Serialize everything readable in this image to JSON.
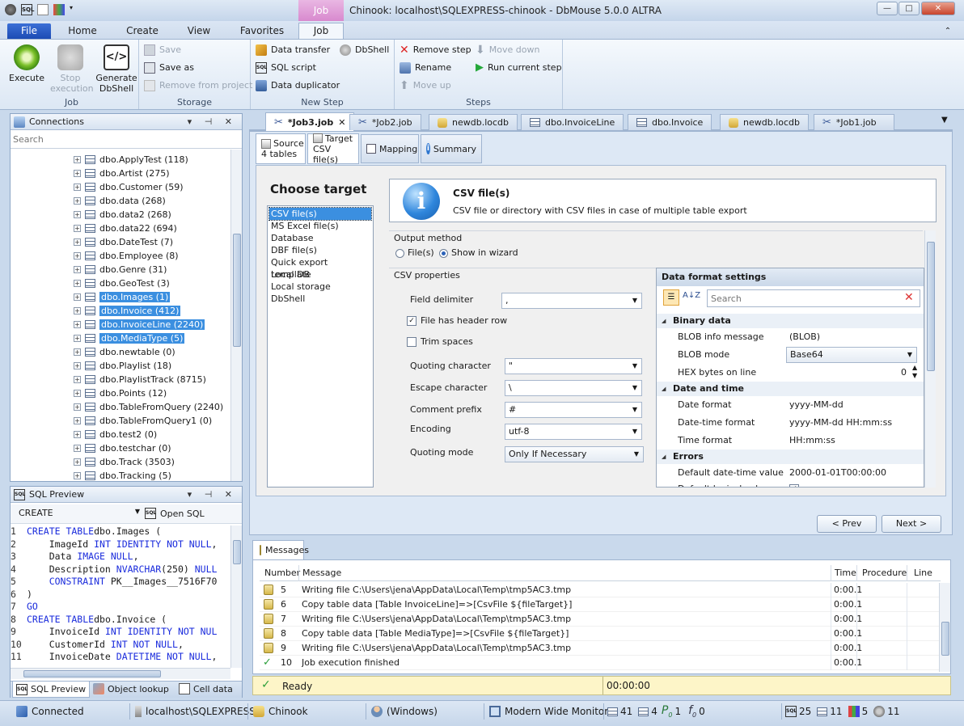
{
  "window": {
    "title": "Chinook: localhost\\SQLEXPRESS-chinook - DbMouse 5.0.0 ALTRA",
    "context_tab": "Job",
    "min": "—",
    "max": "□",
    "close": "✕"
  },
  "ribbon_tabs": [
    "File",
    "Home",
    "Create",
    "View",
    "Favorites",
    "Job"
  ],
  "ribbon": {
    "job_group": {
      "name": "Job",
      "execute": "Execute",
      "stop": "Stop execution",
      "generate": "Generate DbShell"
    },
    "storage_group": {
      "name": "Storage",
      "save": "Save",
      "save_as": "Save as",
      "remove": "Remove from project"
    },
    "newstep_group": {
      "name": "New Step",
      "data_transfer": "Data transfer",
      "dbshell": "DbShell",
      "sql_script": "SQL script",
      "data_duplicator": "Data duplicator"
    },
    "steps_group": {
      "name": "Steps",
      "remove_step": "Remove step",
      "move_down": "Move down",
      "rename": "Rename",
      "run_current": "Run current step",
      "move_up": "Move up"
    }
  },
  "connections": {
    "title": "Connections",
    "search_placeholder": "Search",
    "items": [
      {
        "label": "dbo.ApplyTest (118)",
        "selected": false
      },
      {
        "label": "dbo.Artist (275)",
        "selected": false
      },
      {
        "label": "dbo.Customer (59)",
        "selected": false
      },
      {
        "label": "dbo.data (268)",
        "selected": false
      },
      {
        "label": "dbo.data2 (268)",
        "selected": false
      },
      {
        "label": "dbo.data22 (694)",
        "selected": false
      },
      {
        "label": "dbo.DateTest (7)",
        "selected": false
      },
      {
        "label": "dbo.Employee (8)",
        "selected": false
      },
      {
        "label": "dbo.Genre (31)",
        "selected": false
      },
      {
        "label": "dbo.GeoTest (3)",
        "selected": false
      },
      {
        "label": "dbo.Images (1)",
        "selected": true
      },
      {
        "label": "dbo.Invoice (412)",
        "selected": true
      },
      {
        "label": "dbo.InvoiceLine (2240)",
        "selected": true
      },
      {
        "label": "dbo.MediaType (5)",
        "selected": true
      },
      {
        "label": "dbo.newtable (0)",
        "selected": false
      },
      {
        "label": "dbo.Playlist (18)",
        "selected": false
      },
      {
        "label": "dbo.PlaylistTrack (8715)",
        "selected": false
      },
      {
        "label": "dbo.Points (12)",
        "selected": false
      },
      {
        "label": "dbo.TableFromQuery (2240)",
        "selected": false
      },
      {
        "label": "dbo.TableFromQuery1 (0)",
        "selected": false
      },
      {
        "label": "dbo.test2 (0)",
        "selected": false
      },
      {
        "label": "dbo.testchar (0)",
        "selected": false
      },
      {
        "label": "dbo.Track (3503)",
        "selected": false
      },
      {
        "label": "dbo.Tracking (5)",
        "selected": false
      }
    ]
  },
  "sql_preview": {
    "title": "SQL Preview",
    "mode": "CREATE",
    "open_sql": "Open SQL",
    "lines": [
      {
        "n": "1",
        "parts": [
          [
            "kw",
            "CREATE TABLE"
          ],
          [
            "",
            "dbo.Images ("
          ]
        ]
      },
      {
        "n": "2",
        "parts": [
          [
            "",
            "    ImageId "
          ],
          [
            "kw",
            "INT IDENTITY NOT NULL"
          ],
          [
            "",
            ","
          ]
        ]
      },
      {
        "n": "3",
        "parts": [
          [
            "",
            "    Data "
          ],
          [
            "kw",
            "IMAGE NULL"
          ],
          [
            "",
            ","
          ]
        ]
      },
      {
        "n": "4",
        "parts": [
          [
            "",
            "    Description "
          ],
          [
            "kw",
            "NVARCHAR"
          ],
          [
            "",
            "(250) "
          ],
          [
            "kw",
            "NULL"
          ]
        ]
      },
      {
        "n": "5",
        "parts": [
          [
            "",
            "    "
          ],
          [
            "kw",
            "CONSTRAINT"
          ],
          [
            "",
            " PK__Images__7516F70"
          ]
        ]
      },
      {
        "n": "6",
        "parts": [
          [
            "",
            ")"
          ]
        ]
      },
      {
        "n": "7",
        "parts": [
          [
            "kw",
            "GO"
          ]
        ]
      },
      {
        "n": "8",
        "parts": [
          [
            "kw",
            "CREATE TABLE"
          ],
          [
            "",
            "dbo.Invoice ("
          ]
        ]
      },
      {
        "n": "9",
        "parts": [
          [
            "",
            "    InvoiceId "
          ],
          [
            "kw",
            "INT IDENTITY NOT NUL"
          ]
        ]
      },
      {
        "n": "10",
        "parts": [
          [
            "",
            "    CustomerId "
          ],
          [
            "kw",
            "INT NOT NULL"
          ],
          [
            "",
            ","
          ]
        ]
      },
      {
        "n": "11",
        "parts": [
          [
            "",
            "    InvoiceDate "
          ],
          [
            "kw",
            "DATETIME NOT NULL"
          ],
          [
            "",
            ","
          ]
        ]
      }
    ],
    "bottom_tabs": [
      "SQL Preview",
      "Object lookup",
      "Cell data"
    ]
  },
  "doc_tabs": [
    "*Job3.job",
    "*Job2.job",
    "newdb.locdb",
    "dbo.InvoiceLine",
    "dbo.Invoice",
    "newdb.locdb",
    "*Job1.job"
  ],
  "wizard": {
    "tabs": [
      {
        "title": "Source",
        "sub": "4 tables"
      },
      {
        "title": "Target",
        "sub": "CSV file(s)"
      },
      {
        "title": "Mapping",
        "sub": ""
      },
      {
        "title": "Summary",
        "sub": ""
      }
    ],
    "choose_target": "Choose target",
    "targets": [
      "CSV file(s)",
      "MS Excel file(s)",
      "Database",
      "DBF file(s)",
      "Quick export template",
      "Local DB",
      "Local storage",
      "DbShell"
    ],
    "info": {
      "title": "CSV file(s)",
      "desc": "CSV file or directory with CSV files in case of multiple table export"
    },
    "output_method": {
      "label": "Output method",
      "opt1": "File(s)",
      "opt2": "Show in wizard"
    },
    "csv": {
      "label": "CSV properties",
      "field_delimiter": {
        "label": "Field delimiter",
        "value": ","
      },
      "header_row": "File has header row",
      "trim_spaces": "Trim spaces",
      "quoting_character": {
        "label": "Quoting character",
        "value": "\""
      },
      "escape_character": {
        "label": "Escape character",
        "value": "\\"
      },
      "comment_prefix": {
        "label": "Comment prefix",
        "value": "#"
      },
      "encoding": {
        "label": "Encoding",
        "value": "utf-8"
      },
      "quoting_mode": {
        "label": "Quoting mode",
        "value": "Only If Necessary"
      }
    },
    "format": {
      "title": "Data format settings",
      "search_placeholder": "Search",
      "binary": {
        "cat": "Binary data",
        "blob_info_k": "BLOB info message",
        "blob_info_v": "(BLOB)",
        "blob_mode_k": "BLOB mode",
        "blob_mode_v": "Base64",
        "hex_k": "HEX bytes on line",
        "hex_v": "0"
      },
      "datetime": {
        "cat": "Date and time",
        "date_k": "Date format",
        "date_v": "yyyy-MM-dd",
        "dt_k": "Date-time format",
        "dt_v": "yyyy-MM-dd HH:mm:ss",
        "time_k": "Time format",
        "time_v": "HH:mm:ss"
      },
      "errors": {
        "cat": "Errors",
        "def_dt_k": "Default date-time value",
        "def_dt_v": "2000-01-01T00:00:00",
        "def_log_k": "Default logical value"
      }
    },
    "prev": "< Prev",
    "next": "Next >"
  },
  "messages": {
    "tab": "Messages",
    "columns": [
      "Number",
      "Message",
      "Time",
      "Procedure",
      "Line"
    ],
    "rows": [
      {
        "n": "5",
        "msg": "Writing file C:\\Users\\jena\\AppData\\Local\\Temp\\tmp5AC3.tmp",
        "time": "0:00.1",
        "ok": false
      },
      {
        "n": "6",
        "msg": "Copy table data [Table InvoiceLine]=>[CsvFile ${fileTarget}]",
        "time": "0:00.1",
        "ok": false
      },
      {
        "n": "7",
        "msg": "Writing file C:\\Users\\jena\\AppData\\Local\\Temp\\tmp5AC3.tmp",
        "time": "0:00.1",
        "ok": false
      },
      {
        "n": "8",
        "msg": "Copy table data [Table MediaType]=>[CsvFile ${fileTarget}]",
        "time": "0:00.1",
        "ok": false
      },
      {
        "n": "9",
        "msg": "Writing file C:\\Users\\jena\\AppData\\Local\\Temp\\tmp5AC3.tmp",
        "time": "0:00.1",
        "ok": false
      },
      {
        "n": "10",
        "msg": "Job execution finished",
        "time": "0:00.1",
        "ok": true
      }
    ],
    "status": "Ready",
    "elapsed": "00:00:00"
  },
  "statusbar": {
    "connected": "Connected",
    "server": "localhost\\SQLEXPRESS",
    "database": "Chinook",
    "user": "(Windows)",
    "monitor": "Modern Wide Monitor",
    "c1": "41",
    "c2": "4",
    "c3": "1",
    "c4": "0",
    "c5": "25",
    "c6": "11",
    "c7": "5",
    "c8": "11"
  },
  "colors": {
    "selection": "#3b8fe0",
    "keyword": "#1a2bdc",
    "ribbon_file": "#2454c4",
    "context_tab": "#d889ce",
    "status_yellow": "#fdf5c8"
  }
}
